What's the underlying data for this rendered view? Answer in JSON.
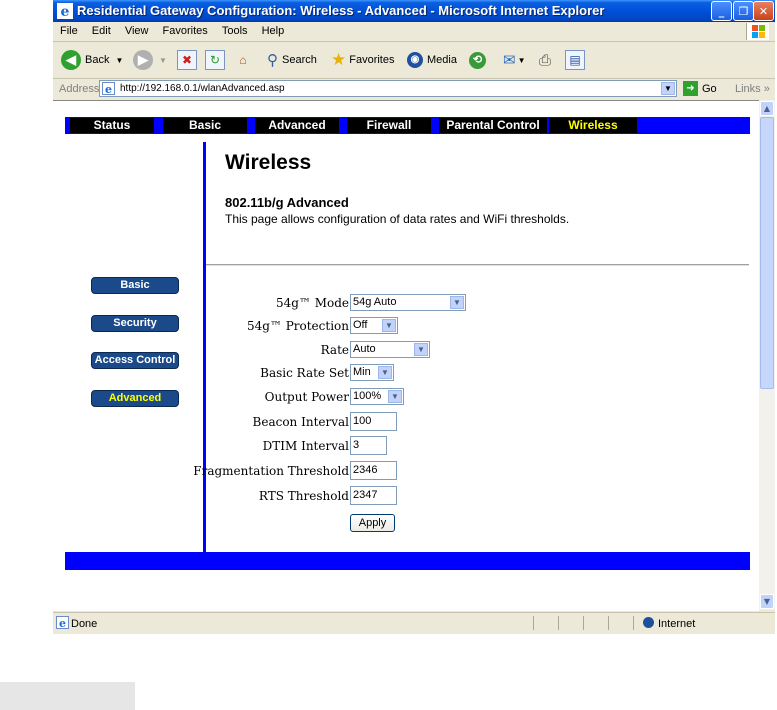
{
  "window": {
    "title": "Residential Gateway Configuration: Wireless - Advanced - Microsoft Internet Explorer"
  },
  "menu": [
    "File",
    "Edit",
    "View",
    "Favorites",
    "Tools",
    "Help"
  ],
  "toolbar": {
    "back": "Back",
    "search": "Search",
    "favorites": "Favorites",
    "media": "Media"
  },
  "address": {
    "label": "Address",
    "url": "http://192.168.0.1/wlanAdvanced.asp",
    "go": "Go",
    "links": "Links"
  },
  "nav": {
    "tabs": [
      "Status",
      "Basic",
      "Advanced",
      "Firewall",
      "Parental Control",
      "Wireless"
    ],
    "active": "Wireless"
  },
  "sidebar": {
    "items": [
      "Basic",
      "Security",
      "Access Control",
      "Advanced"
    ],
    "active": "Advanced"
  },
  "page": {
    "title": "Wireless",
    "subtitle": "802.11b/g Advanced",
    "description": "This page allows configuration of data rates and WiFi thresholds."
  },
  "form": {
    "mode_label": "54g™ Mode",
    "mode_value": "54g Auto",
    "protection_label": "54g™ Protection",
    "protection_value": "Off",
    "rate_label": "Rate",
    "rate_value": "Auto",
    "basic_rate_label": "Basic Rate Set",
    "basic_rate_value": "Min",
    "output_power_label": "Output Power",
    "output_power_value": "100%",
    "beacon_label": "Beacon Interval",
    "beacon_value": "100",
    "dtim_label": "DTIM Interval",
    "dtim_value": "3",
    "frag_label": "Fragmentation Threshold",
    "frag_value": "2346",
    "rts_label": "RTS Threshold",
    "rts_value": "2347",
    "apply_label": "Apply"
  },
  "status": {
    "text": "Done",
    "zone": "Internet"
  },
  "colors": {
    "nav_blue": "#0000ff",
    "active_yellow": "#ffff00",
    "title_blue": "#0050d8"
  }
}
